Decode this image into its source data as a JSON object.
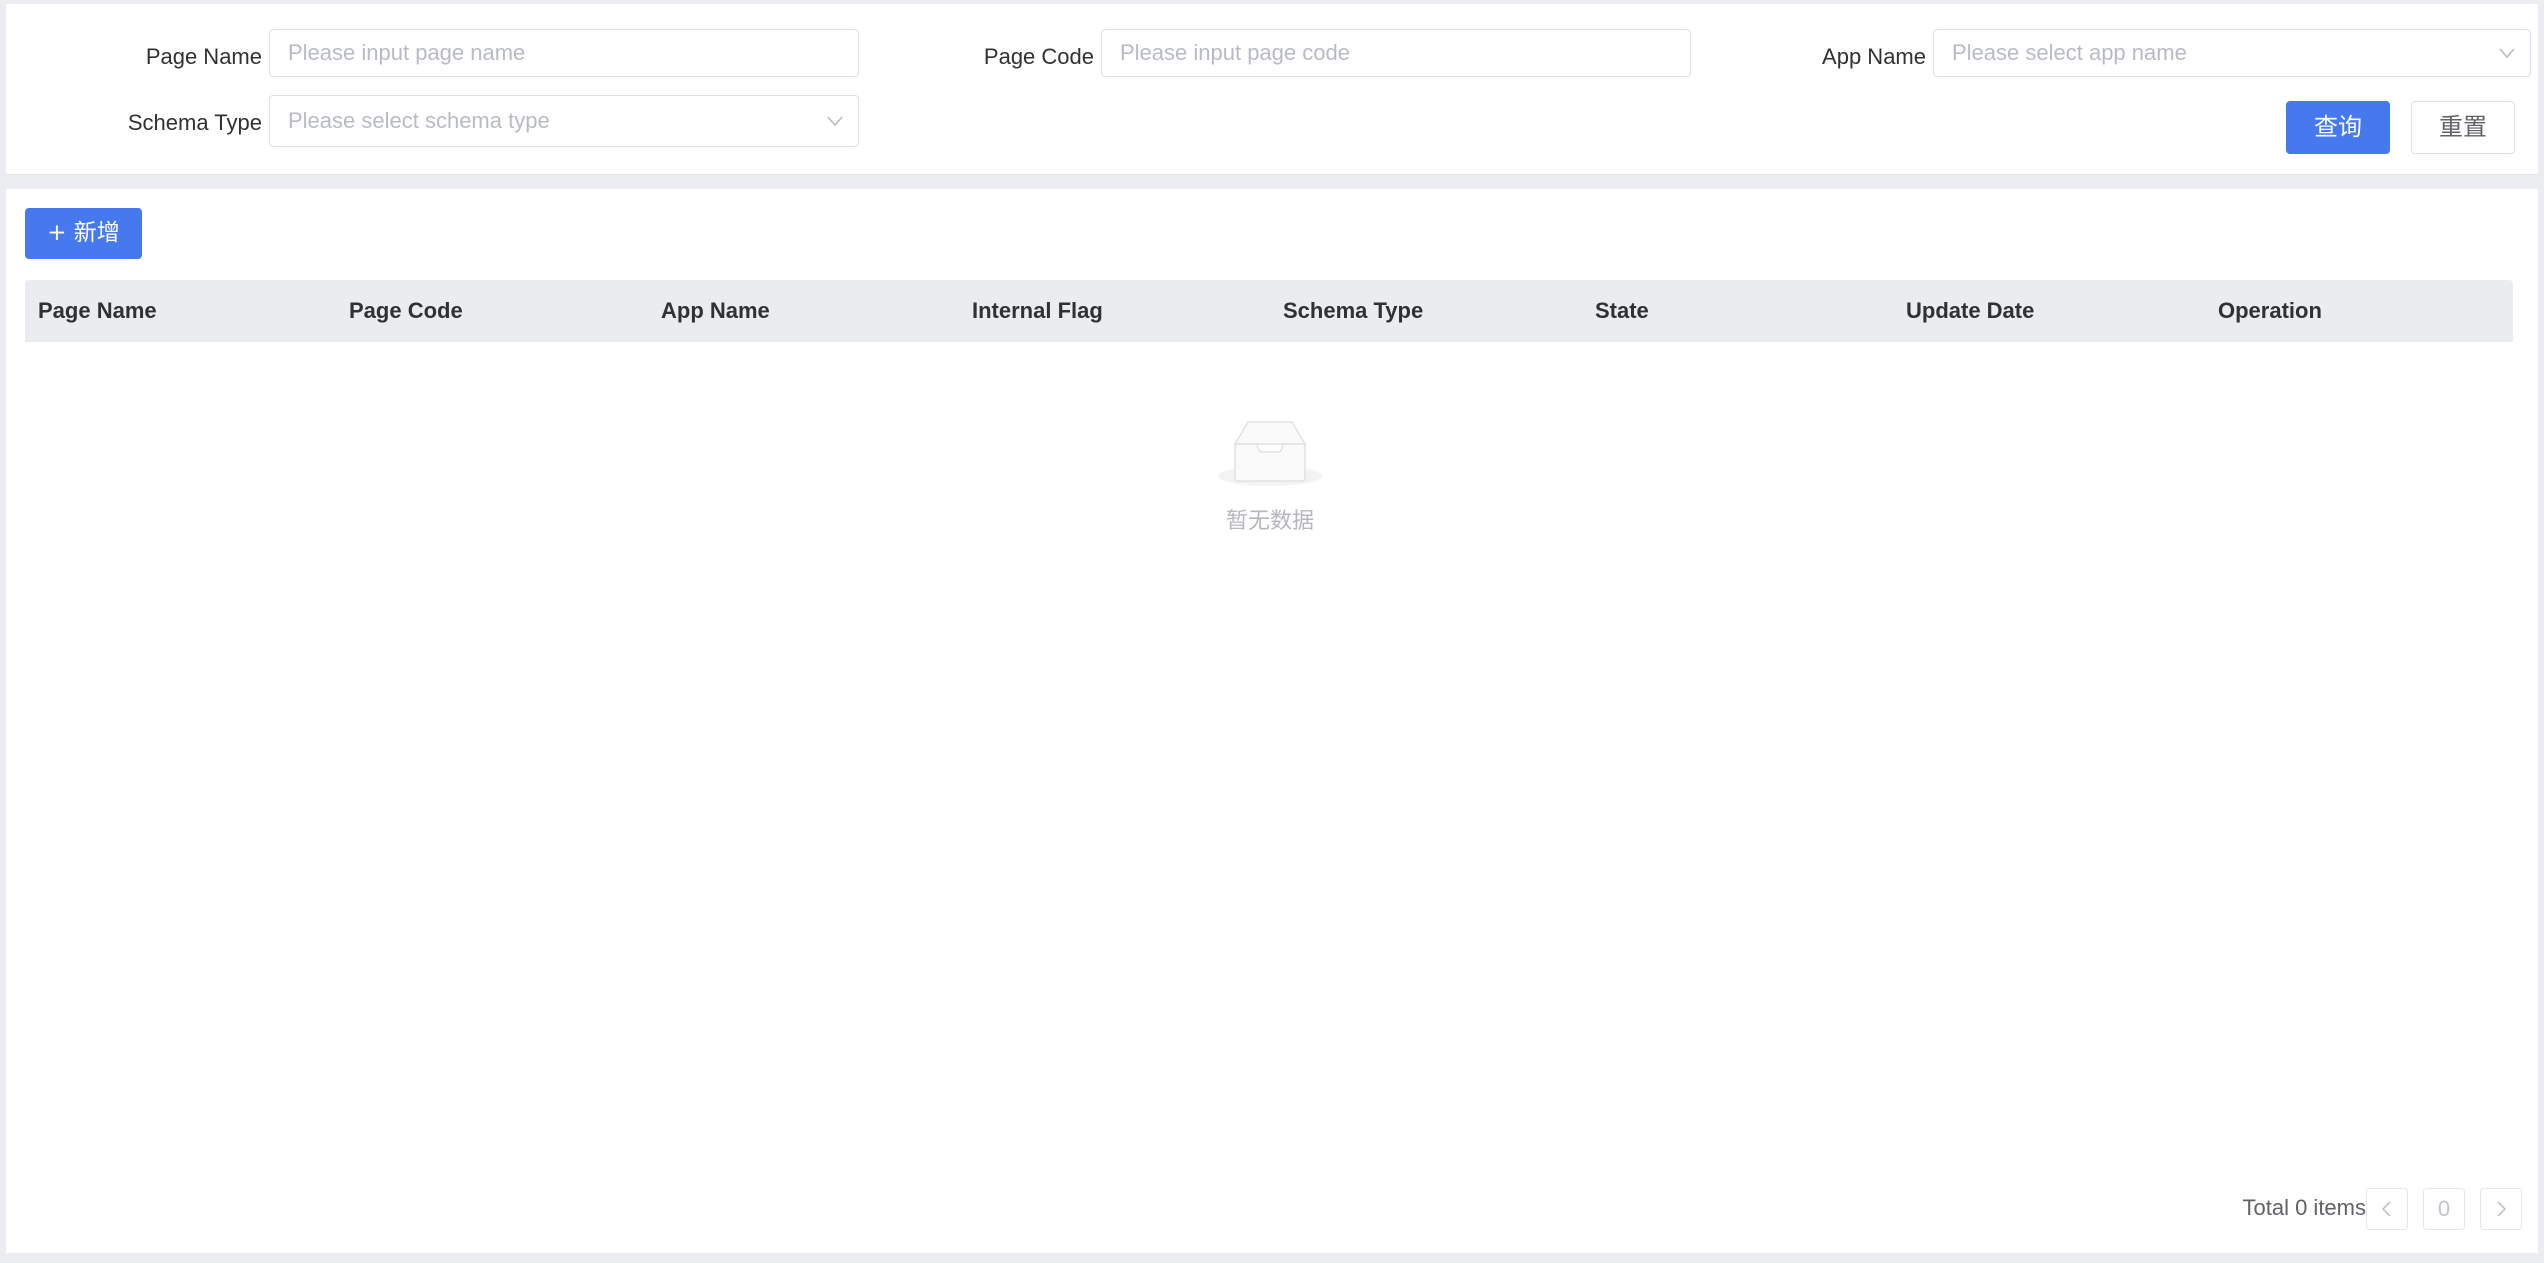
{
  "filters": {
    "page_name": {
      "label": "Page Name",
      "value": "",
      "placeholder": "Please input page name"
    },
    "page_code": {
      "label": "Page Code",
      "value": "",
      "placeholder": "Please input page code"
    },
    "app_name": {
      "label": "App Name",
      "selected": "",
      "placeholder": "Please select app name",
      "icon": "chevron-down-icon"
    },
    "schema_type": {
      "label": "Schema Type",
      "selected": "",
      "placeholder": "Please select schema type",
      "icon": "chevron-down-icon"
    },
    "search_label": "查询",
    "reset_label": "重置"
  },
  "toolbar": {
    "add_label": "+ 新增",
    "primary_color": "#4679ee"
  },
  "table": {
    "columns": [
      "Page Name",
      "Page Code",
      "App Name",
      "Internal Flag",
      "Schema Type",
      "State",
      "Update Date",
      "Operation"
    ],
    "rows": [],
    "empty_text": "暂无数据",
    "empty_icon": "empty-inbox-icon"
  },
  "pagination": {
    "total_text": "Total 0 items",
    "current_page": "0",
    "prev_icon": "chevron-left-icon",
    "next_icon": "chevron-right-icon"
  }
}
